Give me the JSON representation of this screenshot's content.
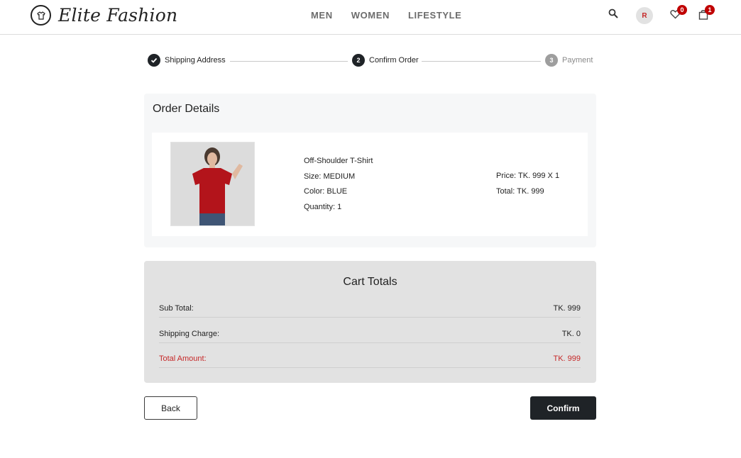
{
  "header": {
    "brand": "Elite Fashion",
    "nav": [
      "MEN",
      "WOMEN",
      "LIFESTYLE"
    ],
    "avatar_initial": "R",
    "wishlist_count": "0",
    "cart_count": "1"
  },
  "stepper": {
    "steps": [
      {
        "label": "Shipping Address",
        "number": "",
        "state": "done"
      },
      {
        "label": "Confirm Order",
        "number": "2",
        "state": "active"
      },
      {
        "label": "Payment",
        "number": "3",
        "state": "pending"
      }
    ]
  },
  "order": {
    "title": "Order Details",
    "item": {
      "name": "Off-Shoulder T-Shirt",
      "size": "Size: MEDIUM",
      "color": "Color: BLUE",
      "quantity": "Quantity: 1",
      "price": "Price: TK. 999 X 1",
      "total": "Total: TK. 999"
    }
  },
  "totals": {
    "title": "Cart Totals",
    "rows": [
      {
        "label": "Sub Total:",
        "value": "TK. 999"
      },
      {
        "label": "Shipping Charge:",
        "value": "TK. 0"
      },
      {
        "label": "Total Amount:",
        "value": "TK. 999"
      }
    ]
  },
  "actions": {
    "back": "Back",
    "confirm": "Confirm"
  },
  "colors": {
    "accent_dark": "#1f2327",
    "badge_red": "#c00000",
    "total_red": "#c62828",
    "panel_bg": "#f6f7f8",
    "totals_bg": "#e2e2e2"
  }
}
